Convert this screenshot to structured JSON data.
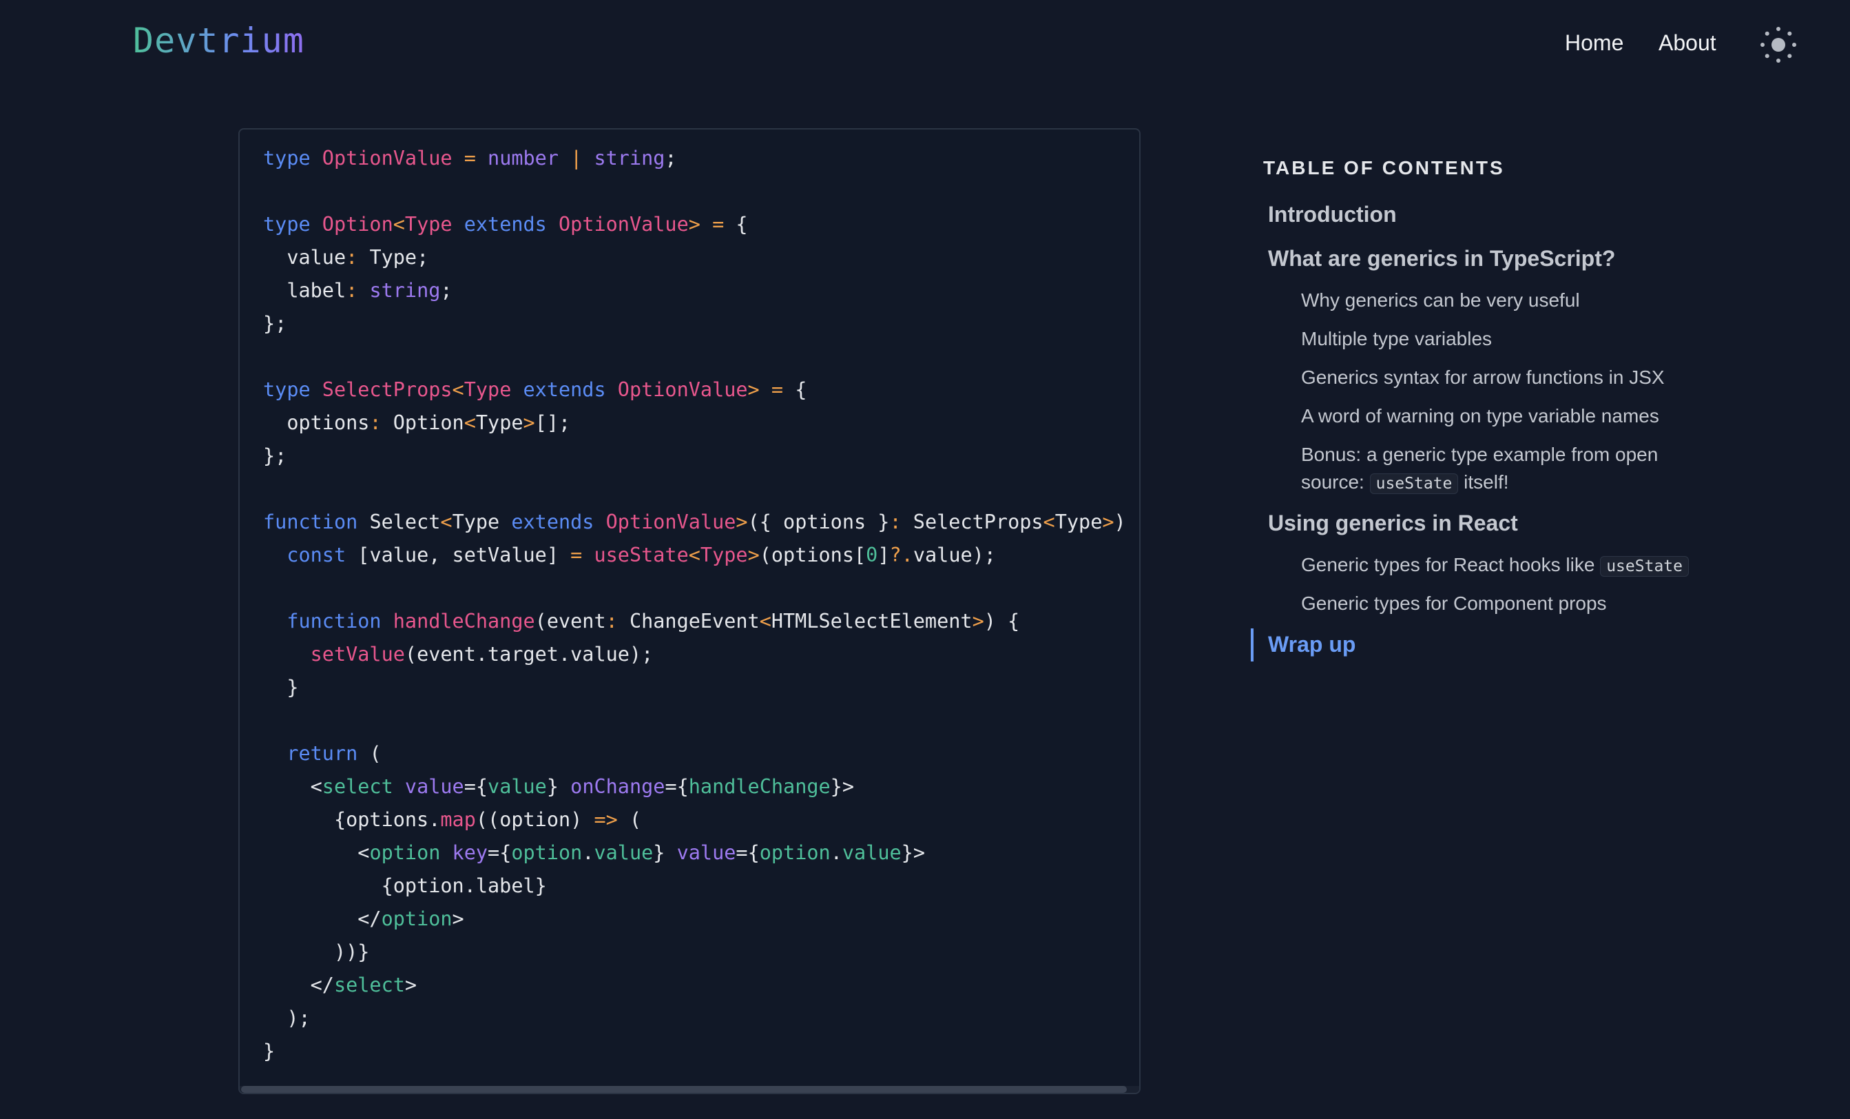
{
  "header": {
    "logo": "Devtrium",
    "nav": {
      "home": "Home",
      "about": "About"
    },
    "theme_toggle_icon": "sun-icon"
  },
  "code": {
    "language": "tsx",
    "lines": [
      [
        [
          "k",
          "type "
        ],
        [
          "t",
          "OptionValue "
        ],
        [
          "o",
          "= "
        ],
        [
          "p",
          "number "
        ],
        [
          "o",
          "| "
        ],
        [
          "p",
          "string"
        ],
        [
          "w",
          ";"
        ]
      ],
      [],
      [
        [
          "k",
          "type "
        ],
        [
          "t",
          "Option"
        ],
        [
          "o",
          "<"
        ],
        [
          "t",
          "Type "
        ],
        [
          "k",
          "extends "
        ],
        [
          "t",
          "OptionValue"
        ],
        [
          "o",
          "> = "
        ],
        [
          "w",
          "{"
        ]
      ],
      [
        [
          "w",
          "  value"
        ],
        [
          "o",
          ": "
        ],
        [
          "w",
          "Type;"
        ]
      ],
      [
        [
          "w",
          "  label"
        ],
        [
          "o",
          ": "
        ],
        [
          "p",
          "string"
        ],
        [
          "w",
          ";"
        ]
      ],
      [
        [
          "w",
          "};"
        ]
      ],
      [],
      [
        [
          "k",
          "type "
        ],
        [
          "t",
          "SelectProps"
        ],
        [
          "o",
          "<"
        ],
        [
          "t",
          "Type "
        ],
        [
          "k",
          "extends "
        ],
        [
          "t",
          "OptionValue"
        ],
        [
          "o",
          "> = "
        ],
        [
          "w",
          "{"
        ]
      ],
      [
        [
          "w",
          "  options"
        ],
        [
          "o",
          ": "
        ],
        [
          "w",
          "Option"
        ],
        [
          "o",
          "<"
        ],
        [
          "w",
          "Type"
        ],
        [
          "o",
          ">"
        ],
        [
          "w",
          "[];"
        ]
      ],
      [
        [
          "w",
          "};"
        ]
      ],
      [],
      [
        [
          "k",
          "function "
        ],
        [
          "w",
          "Select"
        ],
        [
          "o",
          "<"
        ],
        [
          "w",
          "Type "
        ],
        [
          "k",
          "extends "
        ],
        [
          "t",
          "OptionValue"
        ],
        [
          "o",
          ">"
        ],
        [
          "w",
          "({ options }"
        ],
        [
          "o",
          ": "
        ],
        [
          "w",
          "SelectProps"
        ],
        [
          "o",
          "<"
        ],
        [
          "w",
          "Type"
        ],
        [
          "o",
          ">"
        ],
        [
          "w",
          ") {"
        ]
      ],
      [
        [
          "k",
          "  const "
        ],
        [
          "w",
          "[value, setValue] "
        ],
        [
          "o",
          "= "
        ],
        [
          "t",
          "useState"
        ],
        [
          "o",
          "<"
        ],
        [
          "t",
          "Type"
        ],
        [
          "o",
          ">"
        ],
        [
          "w",
          "(options["
        ],
        [
          "g",
          "0"
        ],
        [
          "w",
          "]"
        ],
        [
          "o",
          "?."
        ],
        [
          "w",
          "value);"
        ]
      ],
      [],
      [
        [
          "k",
          "  function "
        ],
        [
          "t",
          "handleChange"
        ],
        [
          "w",
          "(event"
        ],
        [
          "o",
          ": "
        ],
        [
          "w",
          "ChangeEvent"
        ],
        [
          "o",
          "<"
        ],
        [
          "w",
          "HTMLSelectElement"
        ],
        [
          "o",
          ">"
        ],
        [
          "w",
          ") {"
        ]
      ],
      [
        [
          "t",
          "    setValue"
        ],
        [
          "w",
          "(event.target.value);"
        ]
      ],
      [
        [
          "w",
          "  }"
        ]
      ],
      [],
      [
        [
          "k",
          "  return "
        ],
        [
          "w",
          "("
        ]
      ],
      [
        [
          "w",
          "    <"
        ],
        [
          "g",
          "select "
        ],
        [
          "p",
          "value"
        ],
        [
          "w",
          "={"
        ],
        [
          "g",
          "value"
        ],
        [
          "w",
          "} "
        ],
        [
          "p",
          "onChange"
        ],
        [
          "w",
          "={"
        ],
        [
          "g",
          "handleChange"
        ],
        [
          "w",
          "}>"
        ]
      ],
      [
        [
          "w",
          "      {options."
        ],
        [
          "t",
          "map"
        ],
        [
          "w",
          "((option) "
        ],
        [
          "o",
          "=> "
        ],
        [
          "w",
          "("
        ]
      ],
      [
        [
          "w",
          "        <"
        ],
        [
          "g",
          "option "
        ],
        [
          "p",
          "key"
        ],
        [
          "w",
          "={"
        ],
        [
          "g",
          "option"
        ],
        [
          "w",
          "."
        ],
        [
          "g",
          "value"
        ],
        [
          "w",
          "} "
        ],
        [
          "p",
          "value"
        ],
        [
          "w",
          "={"
        ],
        [
          "g",
          "option"
        ],
        [
          "w",
          "."
        ],
        [
          "g",
          "value"
        ],
        [
          "w",
          "}>"
        ]
      ],
      [
        [
          "w",
          "          {option.label}"
        ]
      ],
      [
        [
          "w",
          "        </"
        ],
        [
          "g",
          "option"
        ],
        [
          "w",
          ">"
        ]
      ],
      [
        [
          "w",
          "      ))}"
        ]
      ],
      [
        [
          "w",
          "    </"
        ],
        [
          "g",
          "select"
        ],
        [
          "w",
          ">"
        ]
      ],
      [
        [
          "w",
          "  );"
        ]
      ],
      [
        [
          "w",
          "}"
        ]
      ]
    ]
  },
  "toc": {
    "heading": "TABLE OF CONTENTS",
    "introduction": "Introduction",
    "what_are_generics": "What are generics in TypeScript?",
    "why_useful": "Why generics can be very useful",
    "multiple_vars": "Multiple type variables",
    "arrow_jsx": "Generics syntax for arrow functions in JSX",
    "warning": "A word of warning on type variable names",
    "bonus_line1": "Bonus: a generic type example from open",
    "bonus_source": "source:",
    "bonus_code": "useState",
    "bonus_itself": "itself!",
    "using_in_react": "Using generics in React",
    "hooks_text": "Generic types for React hooks like",
    "hooks_code": "useState",
    "component_props": "Generic types for Component props",
    "wrap_up": "Wrap up",
    "active_item": "Wrap up",
    "active_color": "#6a9cf5"
  }
}
